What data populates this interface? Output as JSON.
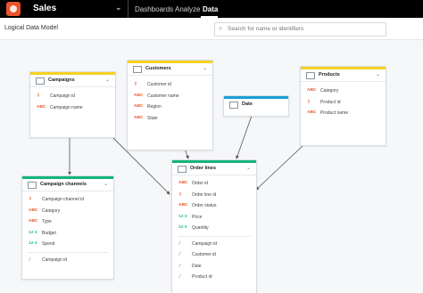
{
  "app": {
    "workspace_title": "Sales",
    "nav": [
      "Dashboards",
      "Analyze",
      "Data"
    ]
  },
  "page": {
    "title": "Logical Data Model",
    "search_placeholder": "Search for name or identifiers"
  },
  "colors": {
    "attribute_dataset_bar": "#f5d124",
    "fact_dataset_bar": "#14b37a",
    "date_dataset_bar": "#1a9ed6",
    "brand": "#e8542c"
  },
  "datasets": {
    "campaigns": {
      "name": "Campaigns",
      "fields": [
        {
          "icon": "key-icon",
          "label": "Campaign id"
        },
        {
          "icon": "abc-icon",
          "label": "Campaign name"
        }
      ]
    },
    "customers": {
      "name": "Customers",
      "fields": [
        {
          "icon": "key-icon",
          "label": "Customer id"
        },
        {
          "icon": "abc-icon",
          "label": "Customer name"
        },
        {
          "icon": "abc-icon",
          "label": "Region"
        },
        {
          "icon": "abc-icon",
          "label": "State"
        }
      ]
    },
    "date": {
      "name": "Date"
    },
    "products": {
      "name": "Products",
      "fields": [
        {
          "icon": "abc-icon",
          "label": "Category"
        },
        {
          "icon": "key-icon",
          "label": "Product id"
        },
        {
          "icon": "abc-icon",
          "label": "Product name"
        }
      ]
    },
    "campaign_channels": {
      "name": "Campaign channels",
      "fields": [
        {
          "icon": "key-icon",
          "label": "Campaign channel id"
        },
        {
          "icon": "abc-icon",
          "label": "Category"
        },
        {
          "icon": "abc-icon",
          "label": "Type"
        },
        {
          "icon": "number-icon",
          "label": "Budget"
        },
        {
          "icon": "number-icon",
          "label": "Spend"
        }
      ],
      "references": [
        {
          "icon": "reference-icon",
          "label": "Campaign id"
        }
      ]
    },
    "order_lines": {
      "name": "Order lines",
      "fields": [
        {
          "icon": "abc-icon",
          "label": "Order id"
        },
        {
          "icon": "key-icon",
          "label": "Order line id"
        },
        {
          "icon": "abc-icon",
          "label": "Order status"
        },
        {
          "icon": "number-icon",
          "label": "Price"
        },
        {
          "icon": "number-icon",
          "label": "Quantity"
        }
      ],
      "references": [
        {
          "icon": "reference-icon",
          "label": "Campaign id"
        },
        {
          "icon": "reference-icon",
          "label": "Customer id"
        },
        {
          "icon": "reference-icon",
          "label": "Date"
        },
        {
          "icon": "reference-icon",
          "label": "Product id"
        }
      ]
    }
  },
  "icon_glyphs": {
    "abc-icon": "ABC",
    "number-icon": "12·3",
    "key-icon": "⚷",
    "reference-icon": "⤤"
  }
}
